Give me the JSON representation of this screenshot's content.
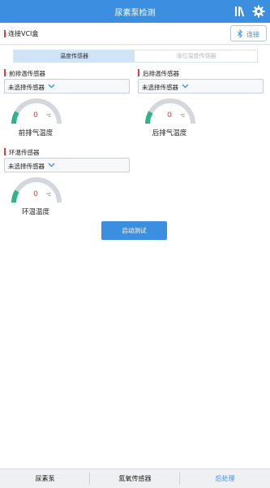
{
  "header": {
    "title": "尿素泵检测",
    "icons": [
      "library-icon",
      "gear-icon"
    ]
  },
  "connection": {
    "label": "连接VCI盒",
    "button_label": "连接",
    "button_icon": "bluetooth-icon"
  },
  "tabs": [
    {
      "label": "温度传感器",
      "active": true
    },
    {
      "label": "液位温度传感器",
      "active": false
    }
  ],
  "sensors": {
    "front": {
      "label": "前排温传感器",
      "select_value": "未选择传感器",
      "gauge_value": "0",
      "unit": "℃",
      "gauge_name": "前排气温度"
    },
    "rear": {
      "label": "后排温传感器",
      "select_value": "未选择传感器",
      "gauge_value": "0",
      "unit": "℃",
      "gauge_name": "后排气温度"
    },
    "ambient": {
      "label": "环温传感器",
      "select_value": "未选择传感器",
      "gauge_value": "0",
      "unit": "℃",
      "gauge_name": "环温温度"
    }
  },
  "start_button": "启动测试",
  "bottom_nav": [
    {
      "label": "尿素泵",
      "active": false
    },
    {
      "label": "氮氧传感器",
      "active": false
    },
    {
      "label": "后处理",
      "active": true
    }
  ],
  "colors": {
    "accent": "#3c8fe0",
    "marker_red": "#e23b3b",
    "gauge_green": "#2eb38a"
  }
}
